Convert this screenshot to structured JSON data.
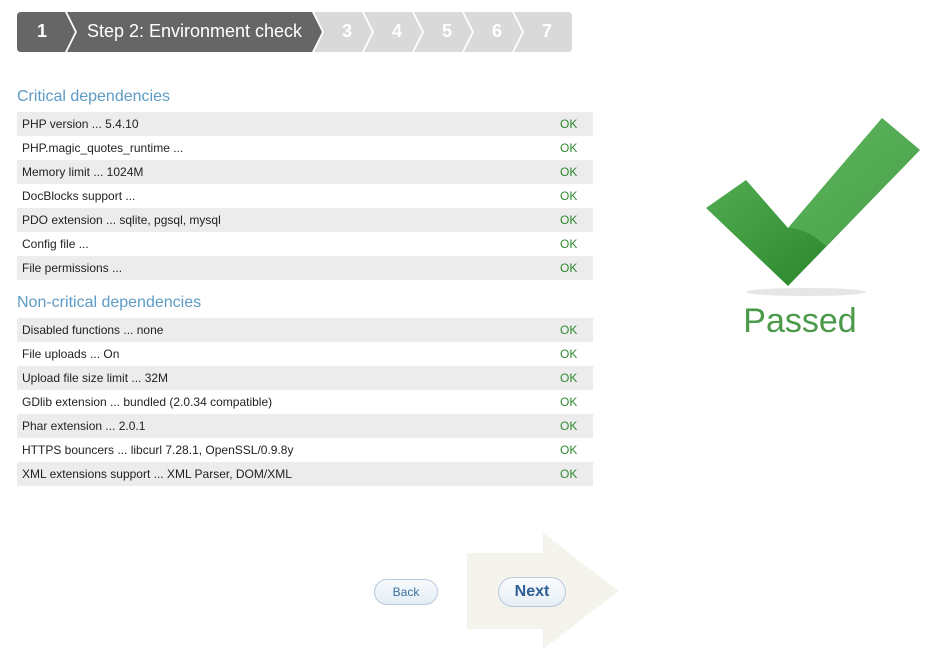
{
  "steps": [
    {
      "label": "1",
      "state": "done"
    },
    {
      "label": "Step 2: Environment check",
      "state": "current"
    },
    {
      "label": "3",
      "state": "future"
    },
    {
      "label": "4",
      "state": "future"
    },
    {
      "label": "5",
      "state": "future"
    },
    {
      "label": "6",
      "state": "future"
    },
    {
      "label": "7",
      "state": "future"
    }
  ],
  "critical": {
    "title": "Critical dependencies",
    "rows": [
      {
        "name": "PHP version ... 5.4.10",
        "status": "OK"
      },
      {
        "name": "PHP.magic_quotes_runtime ...",
        "status": "OK"
      },
      {
        "name": "Memory limit ... 1024M",
        "status": "OK"
      },
      {
        "name": "DocBlocks support ...",
        "status": "OK"
      },
      {
        "name": "PDO extension ... sqlite, pgsql, mysql",
        "status": "OK"
      },
      {
        "name": "Config file ...",
        "status": "OK"
      },
      {
        "name": "File permissions ...",
        "status": "OK"
      }
    ]
  },
  "noncritical": {
    "title": "Non-critical dependencies",
    "rows": [
      {
        "name": "Disabled functions ... none",
        "status": "OK"
      },
      {
        "name": "File uploads ... On",
        "status": "OK"
      },
      {
        "name": "Upload file size limit ... 32M",
        "status": "OK"
      },
      {
        "name": "GDlib extension ... bundled (2.0.34 compatible)",
        "status": "OK"
      },
      {
        "name": "Phar extension ... 2.0.1",
        "status": "OK"
      },
      {
        "name": "HTTPS bouncers ... libcurl 7.28.1, OpenSSL/0.9.8y",
        "status": "OK"
      },
      {
        "name": "XML extensions support ... XML Parser, DOM/XML",
        "status": "OK"
      }
    ]
  },
  "result": {
    "text": "Passed",
    "icon": "checkmark-icon",
    "color": "#4a9a4a"
  },
  "nav": {
    "back_label": "Back",
    "next_label": "Next"
  },
  "colors": {
    "step_done": "#666666",
    "step_future": "#d9d9d9",
    "section_title": "#5b9bc6",
    "ok": "#2e8b2e"
  }
}
